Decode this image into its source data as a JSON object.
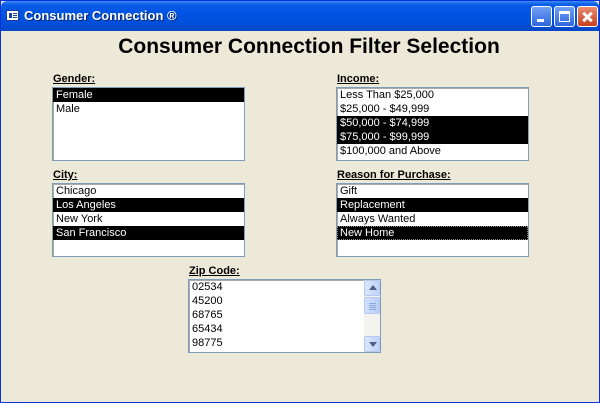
{
  "window": {
    "title": "Consumer Connection ®"
  },
  "form": {
    "title": "Consumer Connection Filter Selection"
  },
  "gender": {
    "label": "Gender:",
    "items": [
      {
        "label": "Female",
        "selected": true
      },
      {
        "label": "Male",
        "selected": false
      }
    ]
  },
  "income": {
    "label": "Income:",
    "items": [
      {
        "label": "Less Than $25,000",
        "selected": false
      },
      {
        "label": "$25,000 - $49,999",
        "selected": false
      },
      {
        "label": "$50,000 - $74,999",
        "selected": true
      },
      {
        "label": "$75,000 - $99,999",
        "selected": true
      },
      {
        "label": "$100,000 and Above",
        "selected": false
      }
    ]
  },
  "city": {
    "label": "City:",
    "items": [
      {
        "label": "Chicago",
        "selected": false
      },
      {
        "label": "Los Angeles",
        "selected": true
      },
      {
        "label": "New York",
        "selected": false
      },
      {
        "label": "San Francisco",
        "selected": true
      }
    ]
  },
  "reason": {
    "label": "Reason for Purchase:",
    "items": [
      {
        "label": "Gift",
        "selected": false
      },
      {
        "label": "Replacement",
        "selected": true
      },
      {
        "label": "Always Wanted",
        "selected": false
      },
      {
        "label": "New Home",
        "selected": true
      }
    ]
  },
  "zip": {
    "label": "Zip Code:",
    "items": [
      {
        "label": "02534",
        "selected": false
      },
      {
        "label": "45200",
        "selected": false
      },
      {
        "label": "68765",
        "selected": false
      },
      {
        "label": "65434",
        "selected": false
      },
      {
        "label": "98775",
        "selected": false
      }
    ]
  }
}
